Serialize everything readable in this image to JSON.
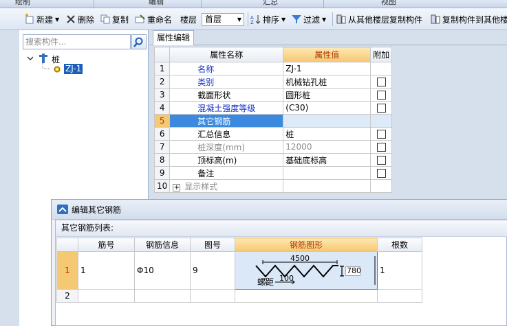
{
  "top_tabs": [
    "绘制",
    "编辑",
    "汇总",
    "视图"
  ],
  "toolbar": {
    "new_label": "新建",
    "delete_label": "删除",
    "copy_label": "复制",
    "rename_label": "重命名",
    "floor_label": "楼层",
    "floor_value": "首层",
    "sort_label": "排序",
    "filter_label": "过滤",
    "copy_from_floor_label": "从其他楼层复制构件",
    "copy_to_floor_label": "复制构件到其他楼"
  },
  "search": {
    "placeholder": "搜索构件..."
  },
  "tree": {
    "root_label": "桩",
    "child_label": "ZJ-1"
  },
  "property_editor": {
    "tab_label": "属性编辑",
    "headers": {
      "name": "属性名称",
      "value": "属性值",
      "extra": "附加"
    },
    "rows": [
      {
        "num": "1",
        "name": "名称",
        "value": "ZJ-1",
        "checkbox": false
      },
      {
        "num": "2",
        "name": "类别",
        "value": "机械钻孔桩",
        "checkbox": true
      },
      {
        "num": "3",
        "name": "截面形状",
        "value": "圆形桩",
        "checkbox": true
      },
      {
        "num": "4",
        "name": "混凝土强度等级",
        "value": "(C30)",
        "checkbox": true
      },
      {
        "num": "5",
        "name": "其它钢筋",
        "value": "",
        "checkbox": false
      },
      {
        "num": "6",
        "name": "汇总信息",
        "value": "桩",
        "checkbox": true
      },
      {
        "num": "7",
        "name": "桩深度(mm)",
        "value": "12000",
        "checkbox": true
      },
      {
        "num": "8",
        "name": "顶标高(m)",
        "value": "基础底标高",
        "checkbox": true
      },
      {
        "num": "9",
        "name": "备注",
        "value": "",
        "checkbox": true
      },
      {
        "num": "10",
        "name": "显示样式",
        "value": "",
        "checkbox": false,
        "expander": "+"
      }
    ]
  },
  "dialog": {
    "title": "编辑其它钢筋",
    "list_label": "其它钢筋列表:",
    "headers": {
      "bar_no": "筋号",
      "bar_info": "钢筋信息",
      "figure_no": "图号",
      "bar_shape": "钢筋图形",
      "count": "根数"
    },
    "rows": [
      {
        "num": "1",
        "bar_no": "1",
        "bar_info": "Φ10",
        "figure_no": "9",
        "shape": {
          "width_label": "4500",
          "height_label": "780",
          "pitch_word": "螺距",
          "pitch_label": "100"
        },
        "count": "1"
      },
      {
        "num": "2",
        "bar_no": "",
        "bar_info": "",
        "figure_no": "",
        "count": ""
      }
    ]
  }
}
